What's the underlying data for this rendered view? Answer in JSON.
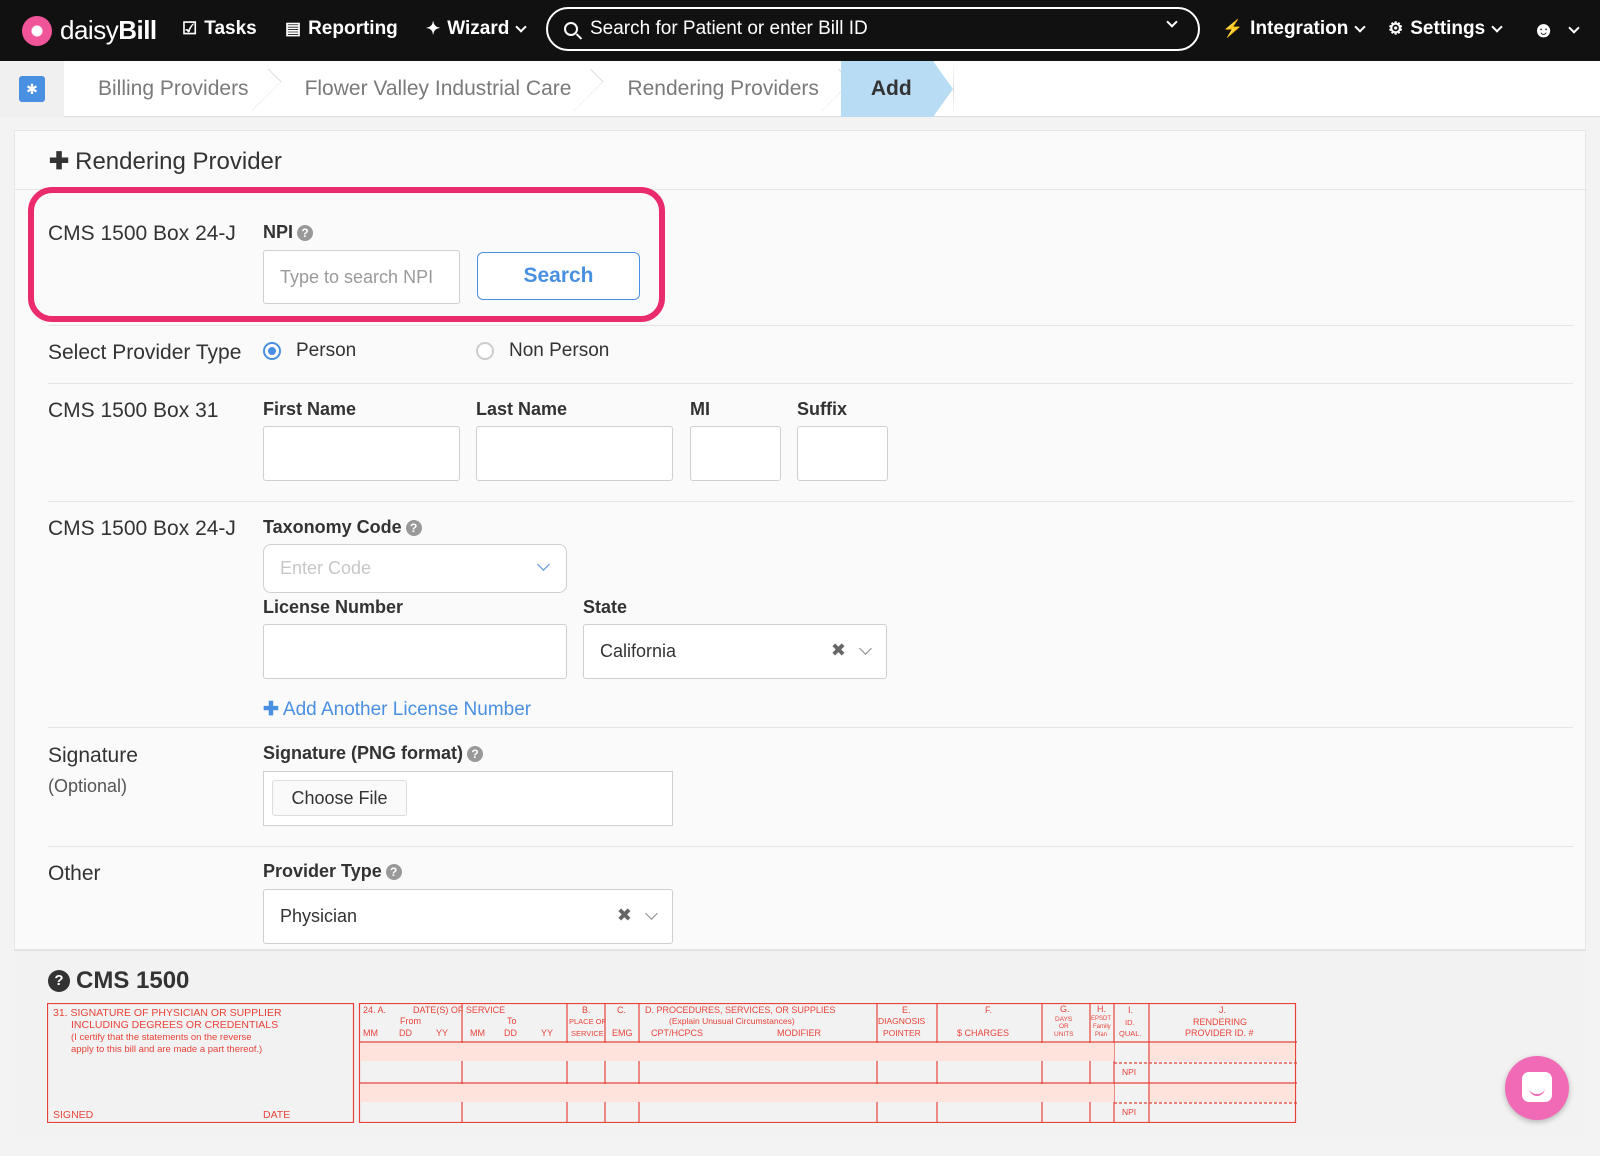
{
  "nav": {
    "brand_light": "daisy",
    "brand_bold": "Bill",
    "tasks": "Tasks",
    "reporting": "Reporting",
    "wizard": "Wizard",
    "search_placeholder": "Search for Patient or enter Bill ID",
    "integration": "Integration",
    "settings": "Settings"
  },
  "breadcrumb": [
    "Billing Providers",
    "Flower Valley Industrial Care",
    "Rendering Providers",
    "Add"
  ],
  "panel_title": "Rendering Provider",
  "npi_section": {
    "label": "CMS 1500 Box 24-J",
    "field_label": "NPI",
    "placeholder": "Type to search NPI",
    "search_button": "Search"
  },
  "provider_type": {
    "label": "Select Provider Type",
    "options": [
      "Person",
      "Non Person"
    ],
    "selected": "Person"
  },
  "box31": {
    "label": "CMS 1500 Box 31",
    "first_name": "First Name",
    "last_name": "Last Name",
    "mi": "MI",
    "suffix": "Suffix"
  },
  "taxonomy": {
    "label": "CMS 1500 Box 24-J",
    "taxonomy_label": "Taxonomy Code",
    "taxonomy_placeholder": "Enter Code",
    "license_label": "License Number",
    "state_label": "State",
    "state_value": "California",
    "add_license": "Add Another License Number"
  },
  "signature": {
    "label": "Signature",
    "optional": "(Optional)",
    "field_label": "Signature (PNG format)",
    "choose_file": "Choose File"
  },
  "other": {
    "label": "Other",
    "provider_type_label": "Provider Type",
    "provider_type_value": "Physician"
  },
  "cms1500": {
    "title": "CMS 1500",
    "box31_text": [
      "31. SIGNATURE OF PHYSICIAN OR SUPPLIER",
      "INCLUDING DEGREES OR CREDENTIALS",
      "(I certify that the statements on the reverse",
      "apply to this bill and are made a part thereof.)"
    ],
    "signed": "SIGNED",
    "date": "DATE",
    "col_24a": "24. A.",
    "col_dates": "DATE(S) OF SERVICE",
    "from": "From",
    "to": "To",
    "mm": "MM",
    "dd": "DD",
    "yy": "YY",
    "col_b": "B.",
    "col_b_sub": [
      "PLACE OF",
      "SERVICE"
    ],
    "col_c": "C.",
    "emg": "EMG",
    "col_d": "D. PROCEDURES, SERVICES, OR SUPPLIES",
    "col_d_sub": "(Explain Unusual Circumstances)",
    "cpt": "CPT/HCPCS",
    "modifier": "MODIFIER",
    "col_e": "E.",
    "col_e_sub": [
      "DIAGNOSIS",
      "POINTER"
    ],
    "col_f": "F.",
    "charges": "$ CHARGES",
    "col_g": "G.",
    "col_g_sub": [
      "DAYS",
      "OR",
      "UNITS"
    ],
    "col_h": "H.",
    "col_h_sub": [
      "EPSDT",
      "Family",
      "Plan"
    ],
    "col_i": "I.",
    "col_i_sub": [
      "ID.",
      "QUAL."
    ],
    "col_j": "J.",
    "col_j_sub": [
      "RENDERING",
      "PROVIDER ID. #"
    ],
    "npi": "NPI",
    "form_color": "#e8433a"
  }
}
